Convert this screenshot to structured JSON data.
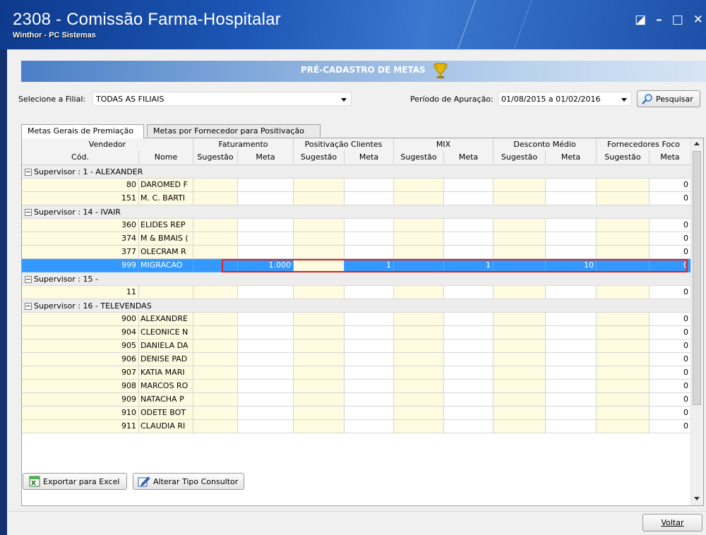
{
  "window": {
    "title": "2308 - Comissão Farma-Hospitalar",
    "subtitle": "Winthor - PC Sistemas"
  },
  "header": {
    "title": "PRÉ-CADASTRO DE METAS"
  },
  "filters": {
    "filial_label": "Selecione a Filial:",
    "filial_value": "TODAS AS FILIAIS",
    "periodo_label": "Período de Apuração:",
    "periodo_value": "01/08/2015 a 01/02/2016",
    "search_label": "Pesquisar"
  },
  "tabs": [
    {
      "label": "Metas Gerais de Premiação",
      "active": true
    },
    {
      "label": "Metas por Fornecedor para Positivação",
      "active": false
    }
  ],
  "grid": {
    "groups_header": [
      "Vendedor",
      "Faturamento",
      "Positivação Clientes",
      "MIX",
      "Desconto Médio",
      "Fornecedores Foco"
    ],
    "columns": [
      "Cód.",
      "Nome",
      "Sugestão",
      "Meta",
      "Sugestão",
      "Meta",
      "Sugestão",
      "Meta",
      "Sugestão",
      "Meta",
      "Sugestão",
      "Meta"
    ],
    "sections": [
      {
        "label": "Supervisor : 1 - ALEXANDER",
        "rows": [
          {
            "cod": "80",
            "nome": "DAROMED F",
            "fat": "",
            "pos": "",
            "mix": "",
            "desc": "",
            "foco": "0"
          },
          {
            "cod": "151",
            "nome": "M. C. BARTI",
            "fat": "",
            "pos": "",
            "mix": "",
            "desc": "",
            "foco": "0"
          }
        ]
      },
      {
        "label": "Supervisor : 14 - IVAIR",
        "rows": [
          {
            "cod": "360",
            "nome": "ELIDES REP",
            "fat": "",
            "pos": "",
            "mix": "",
            "desc": "",
            "foco": "0"
          },
          {
            "cod": "374",
            "nome": "M & BMAIS (",
            "fat": "",
            "pos": "",
            "mix": "",
            "desc": "",
            "foco": "0"
          },
          {
            "cod": "377",
            "nome": "OLECRAM R",
            "fat": "",
            "pos": "",
            "mix": "",
            "desc": "",
            "foco": "0"
          },
          {
            "cod": "999",
            "nome": "MIGRACAO",
            "fat": "1.000",
            "pos": "1",
            "mix": "1",
            "desc": "10",
            "foco": "0",
            "selected": true
          }
        ]
      },
      {
        "label": "Supervisor : 15 -",
        "rows": [
          {
            "cod": "11",
            "nome": "",
            "fat": "",
            "pos": "",
            "mix": "",
            "desc": "",
            "foco": "0"
          }
        ]
      },
      {
        "label": "Supervisor : 16 - TELEVENDAS",
        "rows": [
          {
            "cod": "900",
            "nome": "ALEXANDRE",
            "fat": "",
            "pos": "",
            "mix": "",
            "desc": "",
            "foco": "0"
          },
          {
            "cod": "904",
            "nome": "CLEONICE N",
            "fat": "",
            "pos": "",
            "mix": "",
            "desc": "",
            "foco": "0"
          },
          {
            "cod": "905",
            "nome": "DANIELA DA",
            "fat": "",
            "pos": "",
            "mix": "",
            "desc": "",
            "foco": "0"
          },
          {
            "cod": "906",
            "nome": "DENISE PAD",
            "fat": "",
            "pos": "",
            "mix": "",
            "desc": "",
            "foco": "0"
          },
          {
            "cod": "907",
            "nome": "KATIA MARI",
            "fat": "",
            "pos": "",
            "mix": "",
            "desc": "",
            "foco": "0"
          },
          {
            "cod": "908",
            "nome": "MARCOS RO",
            "fat": "",
            "pos": "",
            "mix": "",
            "desc": "",
            "foco": "0"
          },
          {
            "cod": "909",
            "nome": "NATACHA P",
            "fat": "",
            "pos": "",
            "mix": "",
            "desc": "",
            "foco": "0"
          },
          {
            "cod": "910",
            "nome": "ODETE BOT",
            "fat": "",
            "pos": "",
            "mix": "",
            "desc": "",
            "foco": "0"
          },
          {
            "cod": "911",
            "nome": "CLAUDIA RI",
            "fat": "",
            "pos": "",
            "mix": "",
            "desc": "",
            "foco": "0"
          }
        ]
      }
    ]
  },
  "buttons": {
    "export_excel": "Exportar para Excel",
    "alter_tipo": "Alterar Tipo Consultor",
    "voltar": "Voltar"
  },
  "colors": {
    "selected_row": "#3399ff",
    "suggest_cell": "#fefbe0",
    "highlight_box": "#e02020"
  }
}
